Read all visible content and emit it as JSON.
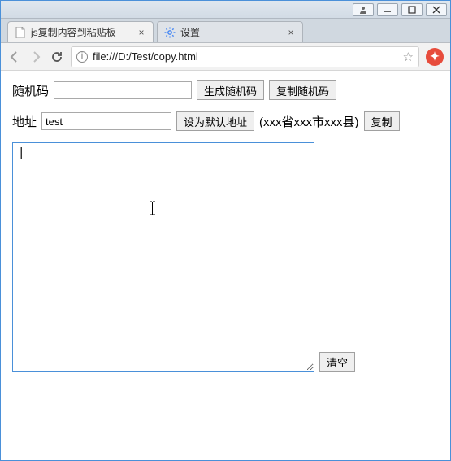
{
  "window": {
    "controls": [
      "avatar",
      "minimize",
      "maximize",
      "close"
    ]
  },
  "tabs": [
    {
      "label": "js复制内容到粘贴板",
      "favicon": "file-icon",
      "active": true
    },
    {
      "label": "设置",
      "favicon": "gear-icon",
      "active": false
    }
  ],
  "toolbar": {
    "back_enabled": false,
    "forward_enabled": false,
    "url": "file:///D:/Test/copy.html"
  },
  "page": {
    "random_label": "随机码",
    "random_value": "",
    "btn_generate": "生成随机码",
    "btn_copy_random": "复制随机码",
    "address_label": "地址",
    "address_value": "test",
    "btn_set_default": "设为默认地址",
    "address_hint": "(xxx省xxx市xxx县)",
    "btn_copy_addr": "复制",
    "textarea_value": "|",
    "btn_clear": "清空"
  }
}
